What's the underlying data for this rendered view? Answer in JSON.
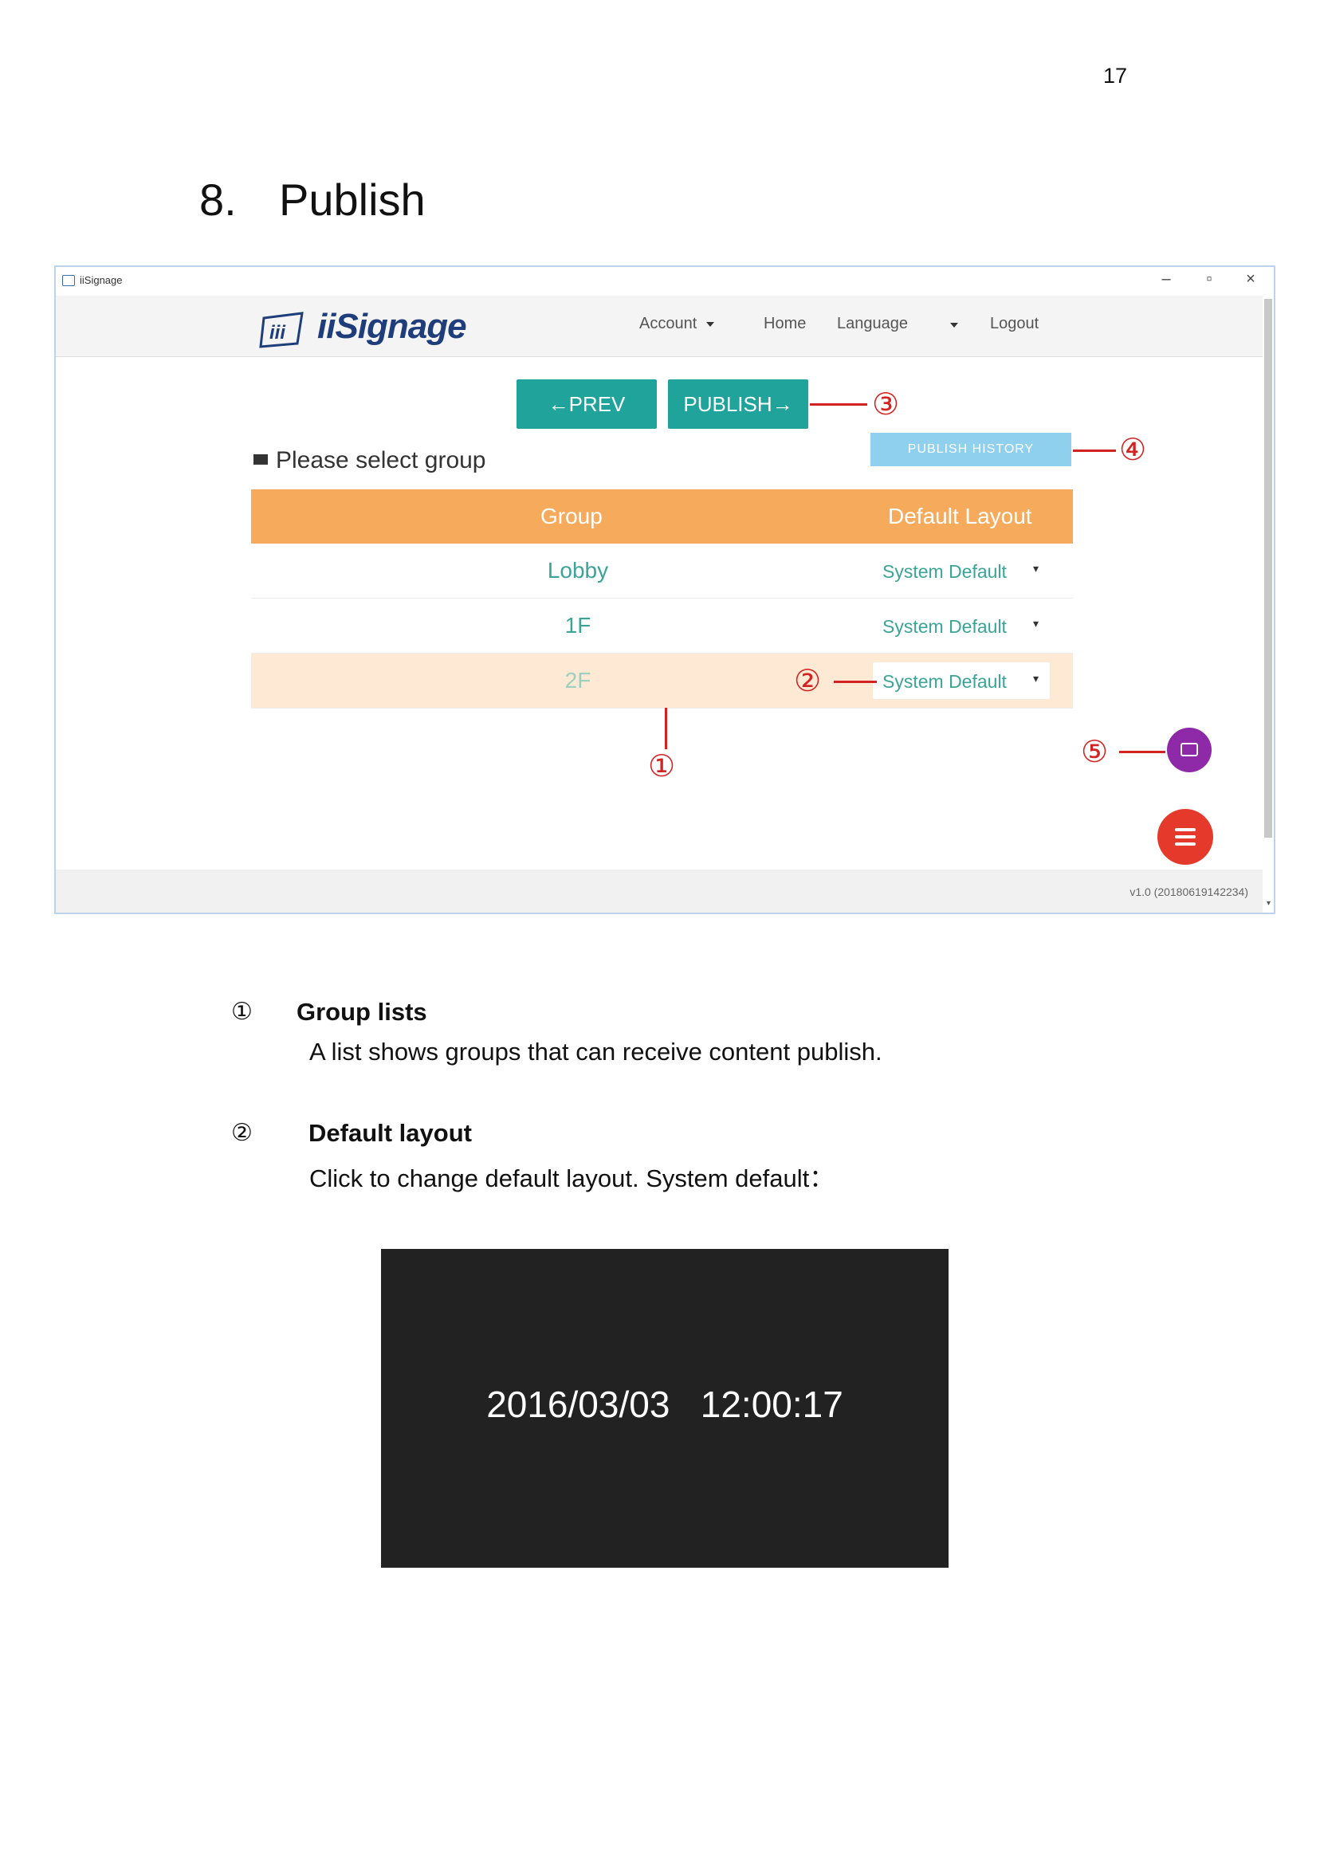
{
  "page": {
    "number": "17",
    "section_number": "8.",
    "section_title": "Publish"
  },
  "app": {
    "window_title": "iiSignage",
    "window_controls": {
      "minimize": "–",
      "maximize": "▫",
      "close": "×"
    },
    "logo_text": "iiSignage",
    "logo_mark": "iii",
    "nav": {
      "account": "Account",
      "home": "Home",
      "language": "Language",
      "logout": "Logout"
    },
    "buttons": {
      "prev": "←PREV",
      "publish": "PUBLISH→",
      "publish_history": "PUBLISH HISTORY"
    },
    "select_group_label": "Please select group",
    "table": {
      "headers": {
        "group": "Group",
        "default_layout": "Default Layout"
      },
      "rows": [
        {
          "group": "Lobby",
          "layout": "System Default"
        },
        {
          "group": "1F",
          "layout": "System Default"
        },
        {
          "group": "2F",
          "layout": "System Default"
        }
      ]
    },
    "version": "v1.0 (20180619142234)"
  },
  "callouts": [
    "①",
    "②",
    "③",
    "④",
    "⑤"
  ],
  "explanations": [
    {
      "num": "①",
      "title": "Group lists",
      "desc": "A list shows groups that can receive content publish."
    },
    {
      "num": "②",
      "title": "Default layout",
      "desc": "Click to change default layout. System default："
    }
  ],
  "preview": {
    "datetime": "2016/03/03   12:00:17"
  }
}
